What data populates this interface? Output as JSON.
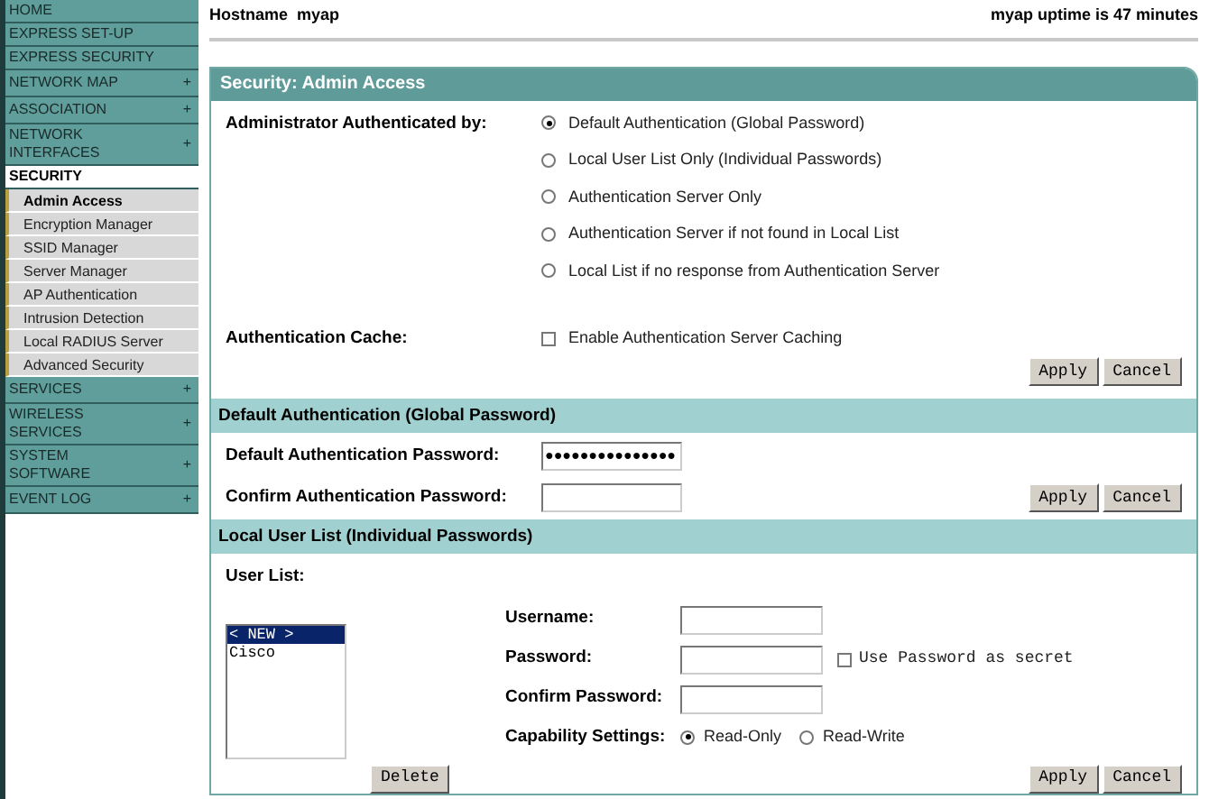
{
  "sidebar": {
    "items": [
      {
        "label": "HOME",
        "kind": "top",
        "selected": false
      },
      {
        "label": "EXPRESS SET-UP",
        "kind": "top",
        "selected": false
      },
      {
        "label": "EXPRESS SECURITY",
        "kind": "top",
        "selected": false
      },
      {
        "label": "NETWORK MAP",
        "kind": "top",
        "expand_icon": "+",
        "selected": false
      },
      {
        "label": "ASSOCIATION",
        "kind": "top",
        "expand_icon": "+",
        "selected": false
      },
      {
        "label": "NETWORK INTERFACES",
        "kind": "top",
        "expand_icon": "+",
        "selected": false
      },
      {
        "label": "SECURITY",
        "kind": "top",
        "selected": true,
        "children": [
          {
            "label": "Admin Access",
            "selected": true
          },
          {
            "label": "Encryption Manager",
            "selected": false
          },
          {
            "label": "SSID Manager",
            "selected": false
          },
          {
            "label": "Server Manager",
            "selected": false
          },
          {
            "label": "AP Authentication",
            "selected": false
          },
          {
            "label": "Intrusion Detection",
            "selected": false
          },
          {
            "label": "Local RADIUS Server",
            "selected": false
          },
          {
            "label": "Advanced Security",
            "selected": false
          }
        ]
      },
      {
        "label": "SERVICES",
        "kind": "top",
        "expand_icon": "+",
        "selected": false
      },
      {
        "label": "WIRELESS SERVICES",
        "kind": "top",
        "expand_icon": "+",
        "selected": false
      },
      {
        "label": "SYSTEM SOFTWARE",
        "kind": "top",
        "expand_icon": "+",
        "selected": false
      },
      {
        "label": "EVENT LOG",
        "kind": "top",
        "expand_icon": "+",
        "selected": false
      }
    ]
  },
  "header": {
    "hostname": "Hostname  myap",
    "uptime": "myap uptime is 47 minutes"
  },
  "admin_access": {
    "title": "Security: Admin Access",
    "auth_label": "Administrator Authenticated by:",
    "options": [
      {
        "label": "Default Authentication (Global Password)",
        "selected": true
      },
      {
        "label": "Local User List Only (Individual Passwords)",
        "selected": false
      },
      {
        "label": "Authentication Server Only",
        "selected": false
      },
      {
        "label": "Authentication Server if not found in Local List",
        "selected": false
      },
      {
        "label": "Local List if no response from Authentication Server",
        "selected": false
      }
    ],
    "cache_label": "Authentication Cache:",
    "cache_option": {
      "label": "Enable Authentication Server Caching",
      "checked": false
    },
    "buttons": [
      "Apply",
      "Cancel"
    ]
  },
  "default_auth": {
    "title": "Default Authentication (Global Password)",
    "password_label": "Default Authentication Password:",
    "password_value": "●●●●●●●●●●●●●●●",
    "confirm_label": "Confirm Authentication Password:",
    "buttons": [
      "Apply",
      "Cancel"
    ]
  },
  "local_users": {
    "title": "Local User List (Individual Passwords)",
    "list_label": "User List:",
    "users": [
      {
        "label": "< NEW >",
        "selected": true
      },
      {
        "label": "Cisco",
        "selected": false
      }
    ],
    "delete_button": "Delete",
    "username_label": "Username:",
    "password_label": "Password:",
    "secret_option": {
      "label": "Use Password as secret",
      "checked": false
    },
    "confirm_label": "Confirm Password:",
    "capability_label": "Capability Settings:",
    "capabilities": [
      {
        "label": "Read-Only",
        "selected": true
      },
      {
        "label": "Read-Write",
        "selected": false
      }
    ],
    "buttons": [
      "Apply",
      "Cancel"
    ]
  }
}
